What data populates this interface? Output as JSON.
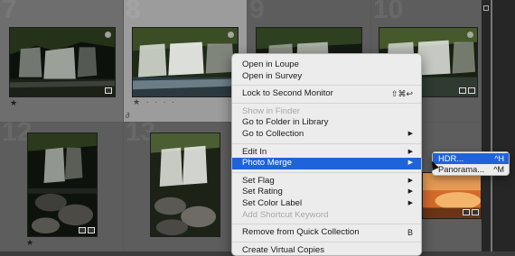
{
  "grid": {
    "cell_numbers": [
      "7",
      "8",
      "9",
      "10",
      "12",
      "13"
    ]
  },
  "context_menu": {
    "items": [
      {
        "label": "Open in Loupe",
        "shortcut": "",
        "submenu": false,
        "disabled": false,
        "highlighted": false
      },
      {
        "label": "Open in Survey",
        "shortcut": "",
        "submenu": false,
        "disabled": false,
        "highlighted": false
      },
      {
        "label": "Lock to Second Monitor",
        "shortcut": "⇧⌘↩",
        "submenu": false,
        "disabled": false,
        "highlighted": false
      },
      {
        "label": "Show in Finder",
        "shortcut": "",
        "submenu": false,
        "disabled": true,
        "highlighted": false
      },
      {
        "label": "Go to Folder in Library",
        "shortcut": "",
        "submenu": false,
        "disabled": false,
        "highlighted": false
      },
      {
        "label": "Go to Collection",
        "shortcut": "▶",
        "submenu": true,
        "disabled": false,
        "highlighted": false
      },
      {
        "label": "Edit In",
        "shortcut": "▶",
        "submenu": true,
        "disabled": false,
        "highlighted": false
      },
      {
        "label": "Photo Merge",
        "shortcut": "▶",
        "submenu": true,
        "disabled": false,
        "highlighted": true
      },
      {
        "label": "Set Flag",
        "shortcut": "▶",
        "submenu": true,
        "disabled": false,
        "highlighted": false
      },
      {
        "label": "Set Rating",
        "shortcut": "▶",
        "submenu": true,
        "disabled": false,
        "highlighted": false
      },
      {
        "label": "Set Color Label",
        "shortcut": "▶",
        "submenu": true,
        "disabled": false,
        "highlighted": false
      },
      {
        "label": "Add Shortcut Keyword",
        "shortcut": "",
        "submenu": false,
        "disabled": true,
        "highlighted": false
      },
      {
        "label": "Remove from Quick Collection",
        "shortcut": "B",
        "submenu": false,
        "disabled": false,
        "highlighted": false
      },
      {
        "label": "Create Virtual Copies",
        "shortcut": "",
        "submenu": false,
        "disabled": false,
        "highlighted": false
      }
    ]
  },
  "submenu": {
    "items": [
      {
        "label": "HDR...",
        "shortcut": "^H",
        "highlighted": true
      },
      {
        "label": "Panorama...",
        "shortcut": "^M",
        "highlighted": false
      }
    ]
  },
  "colors": {
    "highlight": "#1f63d8",
    "menu_bg": "#ececec",
    "grid_bg": "#6e6e6e"
  }
}
